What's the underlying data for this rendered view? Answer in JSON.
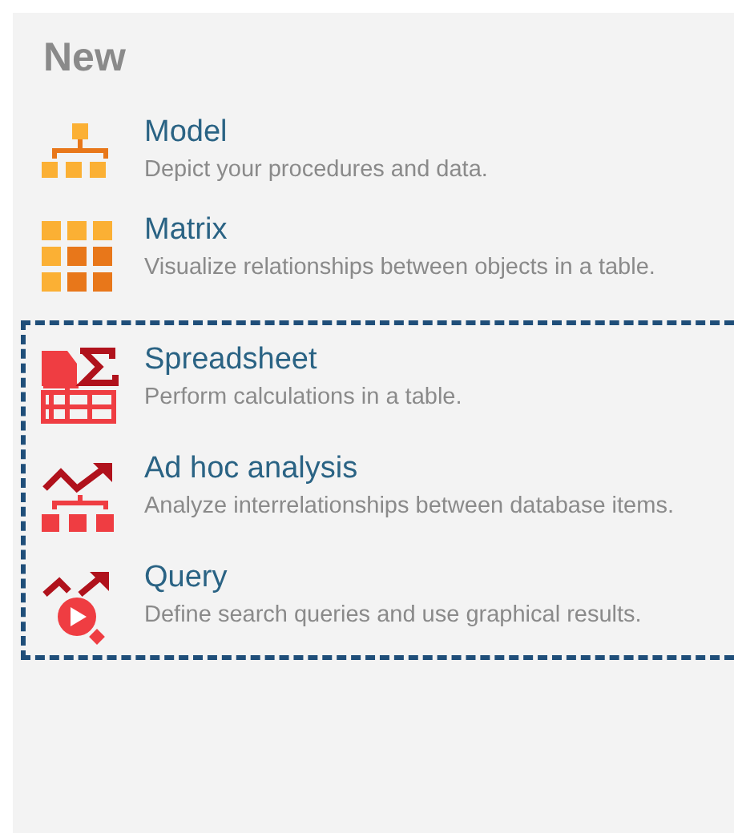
{
  "heading": "New",
  "sections": [
    {
      "outlined": false,
      "items": [
        {
          "kind": "model",
          "title": "Model",
          "description": "Depict your procedures and data."
        },
        {
          "kind": "matrix",
          "title": "Matrix",
          "description": "Visualize relationships between objects in a table."
        }
      ]
    },
    {
      "outlined": true,
      "items": [
        {
          "kind": "spreadsheet",
          "title": "Spreadsheet",
          "description": "Perform calculations in a table."
        },
        {
          "kind": "adhoc",
          "title": "Ad hoc analysis",
          "description": "Analyze interrelationships between database items."
        },
        {
          "kind": "query",
          "title": "Query",
          "description": "Define search queries and use graphical results."
        }
      ]
    }
  ]
}
